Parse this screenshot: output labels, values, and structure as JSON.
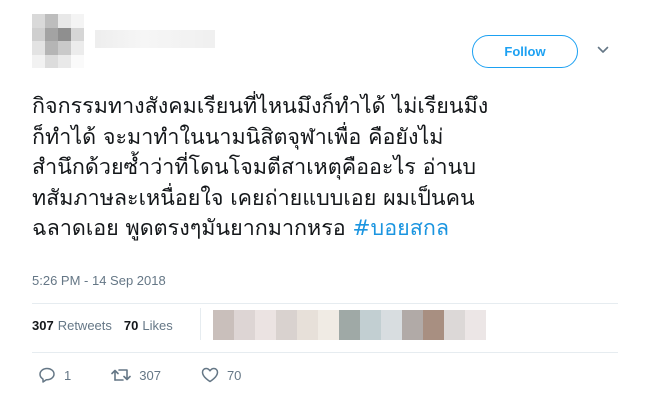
{
  "header": {
    "follow_label": "Follow",
    "accent_color": "#1da1f2"
  },
  "tweet": {
    "lines": [
      "กิจกรรมทางสังคมเรียนที่ไหนมึงก็ทำได้ ไม่เรียนมึง",
      "ก็ทำได้ จะมาทำในนามนิสิตจุฬาเพื่อ คือยังไม่",
      "สำนึกด้วยซ้ำว่าที่โดนโจมตีสาเหตุคืออะไร อ่านบ",
      "ทสัมภาษละเหนื่อยใจ เคยถ่ายแบบเอย ผมเป็นคน",
      "ฉลาดเอย พูดตรงๆมันยากมากหรอ "
    ],
    "hashtag": "#บอยสกล",
    "hashtag_color": "#1b95e0",
    "timestamp": "5:26 PM - 14 Sep 2018"
  },
  "stats": {
    "retweets_count": "307",
    "retweets_label": "Retweets",
    "likes_count": "70",
    "likes_label": "Likes"
  },
  "actions": {
    "reply_count": "1",
    "retweet_count": "307",
    "like_count": "70"
  },
  "icons": [
    "chevron-down-icon",
    "reply-icon",
    "retweet-icon",
    "like-icon"
  ]
}
